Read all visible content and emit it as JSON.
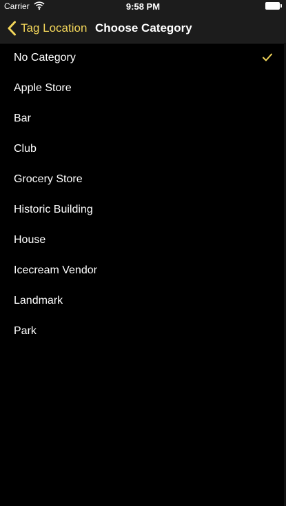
{
  "status_bar": {
    "carrier": "Carrier",
    "time": "9:58 PM",
    "wifi_icon": "wifi-icon",
    "battery_icon": "battery-icon"
  },
  "nav": {
    "back_label": "Tag Location",
    "back_icon": "chevron-left-icon",
    "title": "Choose Category"
  },
  "colors": {
    "accent": "#f3d65a",
    "background": "#000000",
    "bar": "#1c1c1c"
  },
  "categories": [
    {
      "label": "No Category",
      "selected": true
    },
    {
      "label": "Apple Store",
      "selected": false
    },
    {
      "label": "Bar",
      "selected": false
    },
    {
      "label": "Club",
      "selected": false
    },
    {
      "label": "Grocery Store",
      "selected": false
    },
    {
      "label": "Historic Building",
      "selected": false
    },
    {
      "label": "House",
      "selected": false
    },
    {
      "label": "Icecream Vendor",
      "selected": false
    },
    {
      "label": "Landmark",
      "selected": false
    },
    {
      "label": "Park",
      "selected": false
    }
  ]
}
